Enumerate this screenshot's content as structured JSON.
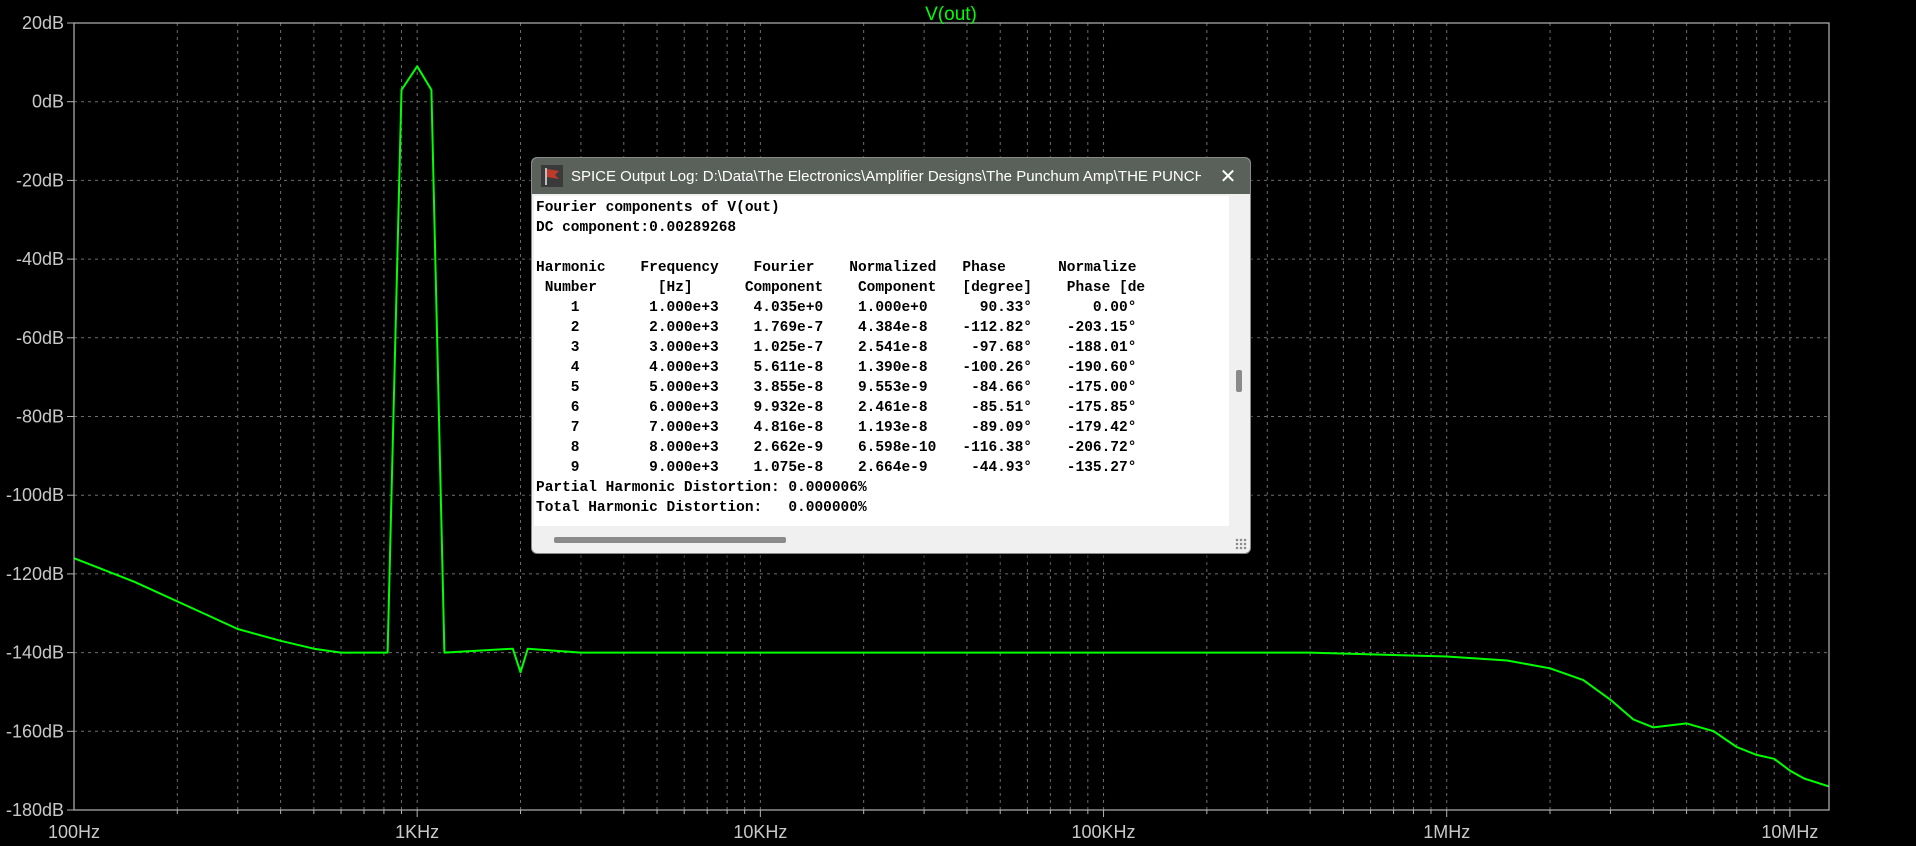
{
  "plot": {
    "trace_title": "V(out)",
    "colors": {
      "background": "#000000",
      "trace": "#00ff00",
      "grid": "#6e6e6e",
      "frame": "#b4b4b4",
      "labels": "#c8c8c8"
    }
  },
  "chart_data": {
    "type": "line",
    "title": "V(out)",
    "xlabel": "",
    "ylabel": "",
    "x_scale": "log",
    "xlim": [
      100,
      13000000
    ],
    "ylim": [
      -180,
      20
    ],
    "grid": true,
    "x_ticks": [
      {
        "value": 100,
        "label": "100Hz"
      },
      {
        "value": 1000,
        "label": "1KHz"
      },
      {
        "value": 10000,
        "label": "10KHz"
      },
      {
        "value": 100000,
        "label": "100KHz"
      },
      {
        "value": 1000000,
        "label": "1MHz"
      },
      {
        "value": 10000000,
        "label": "10MHz"
      }
    ],
    "y_ticks": [
      {
        "value": 20,
        "label": "20dB"
      },
      {
        "value": 0,
        "label": "0dB"
      },
      {
        "value": -20,
        "label": "-20dB"
      },
      {
        "value": -40,
        "label": "-40dB"
      },
      {
        "value": -60,
        "label": "-60dB"
      },
      {
        "value": -80,
        "label": "-80dB"
      },
      {
        "value": -100,
        "label": "-100dB"
      },
      {
        "value": -120,
        "label": "-120dB"
      },
      {
        "value": -140,
        "label": "-140dB"
      },
      {
        "value": -160,
        "label": "-160dB"
      },
      {
        "value": -180,
        "label": "-180dB"
      }
    ],
    "series": [
      {
        "name": "V(out)",
        "color": "#00ff00",
        "points": [
          [
            100,
            -116
          ],
          [
            150,
            -122
          ],
          [
            200,
            -127
          ],
          [
            300,
            -134
          ],
          [
            400,
            -137
          ],
          [
            500,
            -139
          ],
          [
            600,
            -140
          ],
          [
            820,
            -140
          ],
          [
            900,
            3
          ],
          [
            1000,
            9
          ],
          [
            1100,
            3
          ],
          [
            1200,
            -140
          ],
          [
            1900,
            -139
          ],
          [
            2000,
            -145
          ],
          [
            2100,
            -139
          ],
          [
            3000,
            -140
          ],
          [
            100000,
            -140
          ],
          [
            400000,
            -140
          ],
          [
            1000000,
            -141
          ],
          [
            1500000,
            -142
          ],
          [
            2000000,
            -144
          ],
          [
            2500000,
            -147
          ],
          [
            3000000,
            -152
          ],
          [
            3500000,
            -157
          ],
          [
            4000000,
            -159
          ],
          [
            5000000,
            -158
          ],
          [
            6000000,
            -160
          ],
          [
            7000000,
            -164
          ],
          [
            8000000,
            -166
          ],
          [
            9000000,
            -167
          ],
          [
            10000000,
            -170
          ],
          [
            11000000,
            -172
          ],
          [
            13000000,
            -174
          ]
        ]
      }
    ]
  },
  "log_window": {
    "title": "SPICE Output Log: D:\\Data\\The Electronics\\Amplifier Designs\\The Punchum Amp\\THE PUNCHU...",
    "close_symbol": "✕",
    "icon": "spice-flag-icon",
    "lines": [
      "Fourier components of V(out)",
      "DC component:0.00289268",
      "",
      "Harmonic    Frequency    Fourier    Normalized   Phase      Normalize",
      " Number       [Hz]      Component    Component   [degree]    Phase [de",
      "    1        1.000e+3    4.035e+0    1.000e+0      90.33°       0.00°",
      "    2        2.000e+3    1.769e-7    4.384e-8    -112.82°    -203.15°",
      "    3        3.000e+3    1.025e-7    2.541e-8     -97.68°    -188.01°",
      "    4        4.000e+3    5.611e-8    1.390e-8    -100.26°    -190.60°",
      "    5        5.000e+3    3.855e-8    9.553e-9     -84.66°    -175.00°",
      "    6        6.000e+3    9.932e-8    2.461e-8     -85.51°    -175.85°",
      "    7        7.000e+3    4.816e-8    1.193e-8     -89.09°    -179.42°",
      "    8        8.000e+3    2.662e-9    6.598e-10   -116.38°    -206.72°",
      "    9        9.000e+3    1.075e-8    2.664e-9     -44.93°    -135.27°",
      "Partial Harmonic Distortion: 0.000006%",
      "Total Harmonic Distortion:   0.000000%"
    ]
  }
}
